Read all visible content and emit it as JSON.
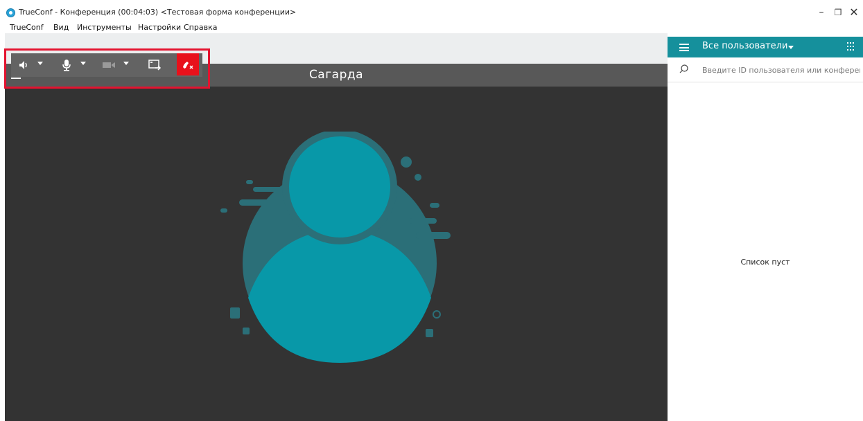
{
  "window": {
    "title": "TrueConf - Конференция (00:04:03) <Тестовая форма конференции>",
    "minimize_glyph": "–",
    "maximize_glyph": "❐",
    "close_glyph": "✕"
  },
  "menu": {
    "items": [
      "TrueConf",
      "Вид",
      "Инструменты",
      "Настройки",
      "Справка"
    ]
  },
  "toolbar": {
    "icons": [
      "speaker-icon",
      "microphone-icon",
      "camera-icon",
      "share-screen-icon",
      "hangup-icon"
    ],
    "highlight_color": "#e4132f",
    "hangup_color": "#e8111b"
  },
  "video": {
    "participant_name": "Сагарда",
    "avatar_color": "#0898a8"
  },
  "sidebar": {
    "title": "Все пользователи",
    "accent_color": "#15909c",
    "search_placeholder": "Введите ID пользователя или конферен...",
    "empty_text": "Список пуст"
  }
}
